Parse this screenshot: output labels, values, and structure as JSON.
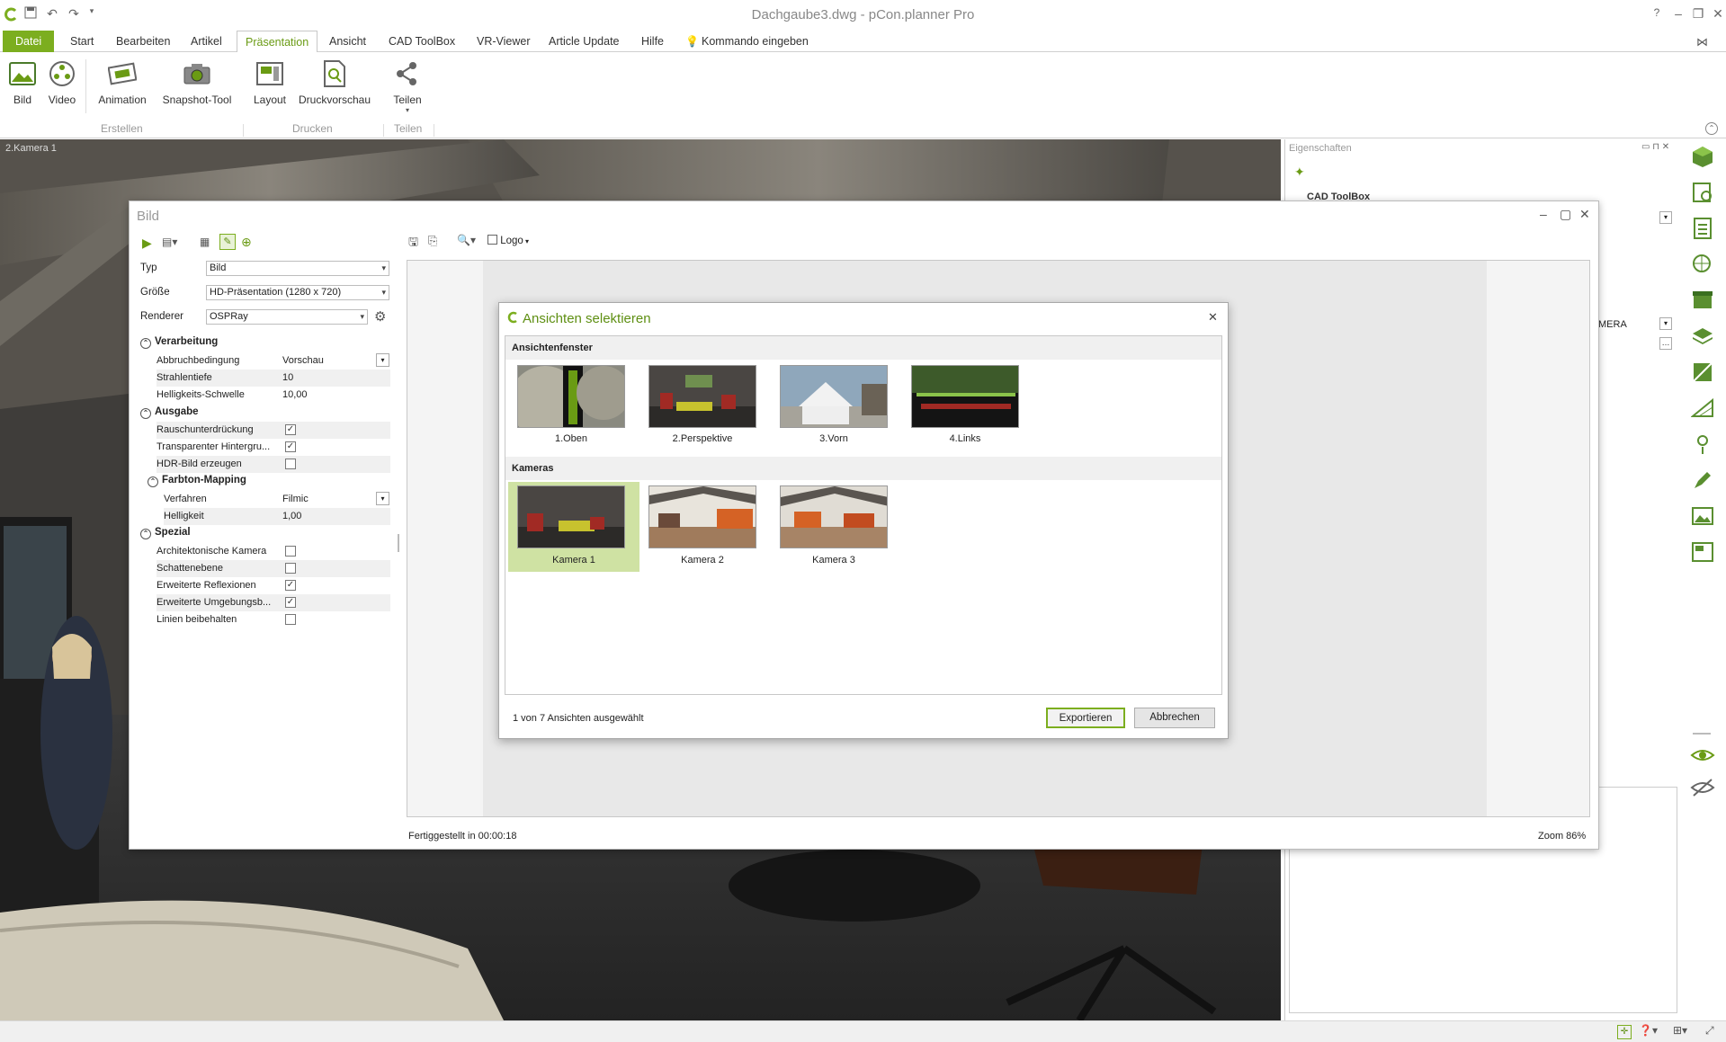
{
  "window": {
    "title": "Dachgaube3.dwg - pCon.planner Pro",
    "help": "?"
  },
  "menu": {
    "items": [
      "Datei",
      "Start",
      "Bearbeiten",
      "Artikel",
      "Präsentation",
      "Ansicht",
      "CAD ToolBox",
      "VR-Viewer",
      "Article Update",
      "Hilfe"
    ],
    "command": "Kommando eingeben"
  },
  "ribbon": {
    "buttons": [
      "Bild",
      "Video",
      "Animation",
      "Snapshot-Tool",
      "Layout",
      "Druckvorschau",
      "Teilen"
    ],
    "groups": [
      "Erstellen",
      "Drucken",
      "Teilen"
    ]
  },
  "viewport": {
    "label": "2.Kamera 1"
  },
  "properties": {
    "title": "Eigenschaften",
    "section": "CAD ToolBox",
    "value_camera": "MERA"
  },
  "bild": {
    "title": "Bild",
    "logo_label": "Logo",
    "typ_label": "Typ",
    "typ_value": "Bild",
    "groesse_label": "Größe",
    "groesse_value": "HD-Präsentation (1280 x 720)",
    "renderer_label": "Renderer",
    "renderer_value": "OSPRay",
    "sections": {
      "verarbeitung": "Verarbeitung",
      "ausgabe": "Ausgabe",
      "farbton": "Farbton-Mapping",
      "spezial": "Spezial"
    },
    "verarbeitung": [
      {
        "label": "Abbruchbedingung",
        "value": "Vorschau"
      },
      {
        "label": "Strahlentiefe",
        "value": "10"
      },
      {
        "label": "Helligkeits-Schwelle",
        "value": "10,00"
      }
    ],
    "ausgabe": [
      {
        "label": "Rauschunterdrückung",
        "checked": true
      },
      {
        "label": "Transparenter Hintergru...",
        "checked": true
      },
      {
        "label": "HDR-Bild erzeugen",
        "checked": false
      }
    ],
    "farbton": [
      {
        "label": "Verfahren",
        "value": "Filmic"
      },
      {
        "label": "Helligkeit",
        "value": "1,00"
      }
    ],
    "spezial": [
      {
        "label": "Architektonische Kamera",
        "checked": false
      },
      {
        "label": "Schattenebene",
        "checked": false
      },
      {
        "label": "Erweiterte Reflexionen",
        "checked": true
      },
      {
        "label": "Erweiterte Umgebungsb...",
        "checked": true
      },
      {
        "label": "Linien beibehalten",
        "checked": false
      }
    ],
    "status": "Fertiggestellt in 00:00:18",
    "zoom": "Zoom 86%"
  },
  "dialog": {
    "title": "Ansichten selektieren",
    "cat_views": "Ansichtenfenster",
    "views": [
      "1.Oben",
      "2.Perspektive",
      "3.Vorn",
      "4.Links"
    ],
    "cat_cameras": "Kameras",
    "cameras": [
      "Kamera 1",
      "Kamera 2",
      "Kamera 3"
    ],
    "selected_camera": 0,
    "status": "1 von 7 Ansichten ausgewählt",
    "export": "Exportieren",
    "cancel": "Abbrechen"
  },
  "colors": {
    "accent": "#7cae1f",
    "selection": "#cfe2a3"
  }
}
